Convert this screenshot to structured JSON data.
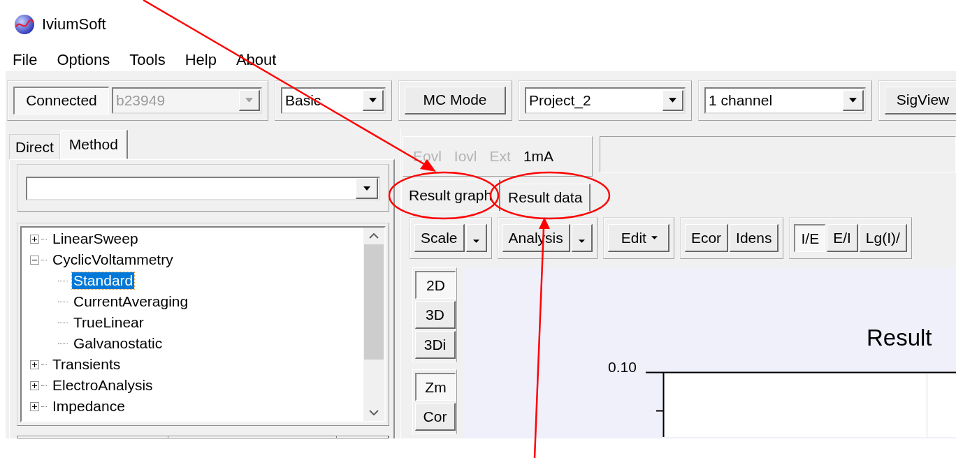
{
  "app": {
    "title": "IviumSoft"
  },
  "menu": [
    "File",
    "Options",
    "Tools",
    "Help",
    "About"
  ],
  "toolbar": [
    {
      "items": [
        {
          "kind": "button",
          "label": "Connected",
          "pressed": true
        },
        {
          "kind": "combo",
          "value": "b23949",
          "disabled": true
        }
      ]
    },
    {
      "items": [
        {
          "kind": "combo",
          "value": "Basic",
          "disabled": false
        }
      ]
    },
    {
      "items": [
        {
          "kind": "button",
          "label": "MC Mode",
          "pressed": false
        }
      ]
    },
    {
      "items": [
        {
          "kind": "combo",
          "value": "Project_2",
          "disabled": false
        }
      ]
    },
    {
      "items": [
        {
          "kind": "combo",
          "value": "1 channel",
          "disabled": false
        }
      ]
    },
    {
      "items": [
        {
          "kind": "button",
          "label": "SigView",
          "pressed": false
        }
      ]
    }
  ],
  "left_tabs": [
    {
      "label": "Direct",
      "selected": false
    },
    {
      "label": "Method",
      "selected": true
    }
  ],
  "tree": [
    {
      "label": "LinearSweep",
      "expanded": false,
      "selected": false
    },
    {
      "label": "CyclicVoltammetry",
      "expanded": true,
      "selected": false,
      "children": [
        {
          "label": "Standard",
          "selected": true
        },
        {
          "label": "CurrentAveraging",
          "selected": false
        },
        {
          "label": "TrueLinear",
          "selected": false
        },
        {
          "label": "Galvanostatic",
          "selected": false
        }
      ]
    },
    {
      "label": "Transients",
      "expanded": false,
      "selected": false
    },
    {
      "label": "ElectroAnalysis",
      "expanded": false,
      "selected": false
    },
    {
      "label": "Impedance",
      "expanded": false,
      "selected": false
    }
  ],
  "indicators": [
    {
      "label": "Eovl",
      "disabled": true
    },
    {
      "label": "Iovl",
      "disabled": true
    },
    {
      "label": "Ext",
      "disabled": true
    },
    {
      "label": "1mA",
      "disabled": false
    }
  ],
  "result_tabs": [
    {
      "label": "Result graph",
      "selected": true
    },
    {
      "label": "Result data",
      "selected": false
    }
  ],
  "graph_toolbar": [
    {
      "items": [
        {
          "kind": "split",
          "label": "Scale"
        }
      ]
    },
    {
      "items": [
        {
          "kind": "split",
          "label": "Analysis"
        }
      ]
    },
    {
      "items": [
        {
          "kind": "menu",
          "label": "Edit"
        }
      ]
    },
    {
      "items": [
        {
          "kind": "button",
          "label": "Ecor",
          "pressed": false
        },
        {
          "kind": "button",
          "label": "Idens",
          "pressed": false
        }
      ]
    },
    {
      "items": [
        {
          "kind": "button",
          "label": "I/E",
          "pressed": true
        },
        {
          "kind": "button",
          "label": "E/I",
          "pressed": false
        },
        {
          "kind": "button",
          "label": "Lg(I)/",
          "pressed": false
        }
      ]
    }
  ],
  "view_buttons": [
    {
      "label": "2D",
      "pressed": true
    },
    {
      "label": "3D",
      "pressed": false
    },
    {
      "label": "3Di",
      "pressed": false
    }
  ],
  "tool_buttons": [
    {
      "label": "Zm",
      "pressed": true
    },
    {
      "label": "Cor",
      "pressed": false
    }
  ],
  "graph": {
    "title": "Result",
    "y_tick_label": "0.10"
  }
}
